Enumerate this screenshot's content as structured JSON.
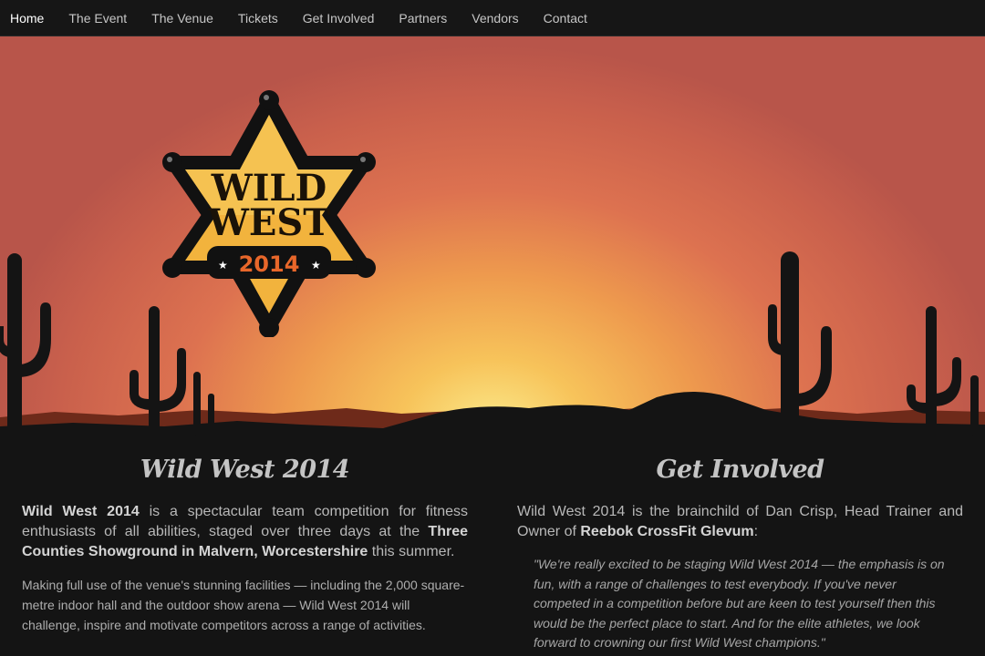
{
  "nav": {
    "items": [
      {
        "label": "Home",
        "active": true
      },
      {
        "label": "The Event"
      },
      {
        "label": "The Venue"
      },
      {
        "label": "Tickets"
      },
      {
        "label": "Get Involved"
      },
      {
        "label": "Partners"
      },
      {
        "label": "Vendors"
      },
      {
        "label": "Contact"
      }
    ]
  },
  "logo": {
    "line1": "WILD",
    "line2": "WEST",
    "year": "2014",
    "icon": "sheriff-star-badge"
  },
  "colors": {
    "sky_center": "#fbe98a",
    "sky_edge": "#b8554a",
    "badge_gold": "#f2b33d",
    "badge_outline": "#111111",
    "year_orange": "#e8672a",
    "background": "#141414"
  },
  "left": {
    "heading": "Wild West 2014",
    "lead_bold_1": "Wild West 2014",
    "lead_text_1": " is a spectacular team competition for fitness enthusiasts of all abilities, staged over three days at the ",
    "lead_bold_2": "Three Counties Showground in Malvern, Worcestershire",
    "lead_text_2": " this summer.",
    "paragraph": "Making full use of the venue's stunning facilities — including the 2,000 square-metre indoor hall and the outdoor show arena — Wild West 2014 will challenge, inspire and motivate competitors across a range of activities."
  },
  "right": {
    "heading": "Get Involved",
    "lead_text_1": "Wild West 2014 is the brainchild of Dan Crisp, Head Trainer and Owner of ",
    "lead_bold_1": "Reebok CrossFit Glevum",
    "lead_text_2": ":",
    "quote": "\"We're really excited to be staging Wild West 2014 — the emphasis is on fun, with a range of challenges to test everybody. If you've never competed in a competition before but are keen to test yourself then this would be the perfect place to start. And for the elite athletes, we look forward to crowning our first Wild West champions.\""
  }
}
